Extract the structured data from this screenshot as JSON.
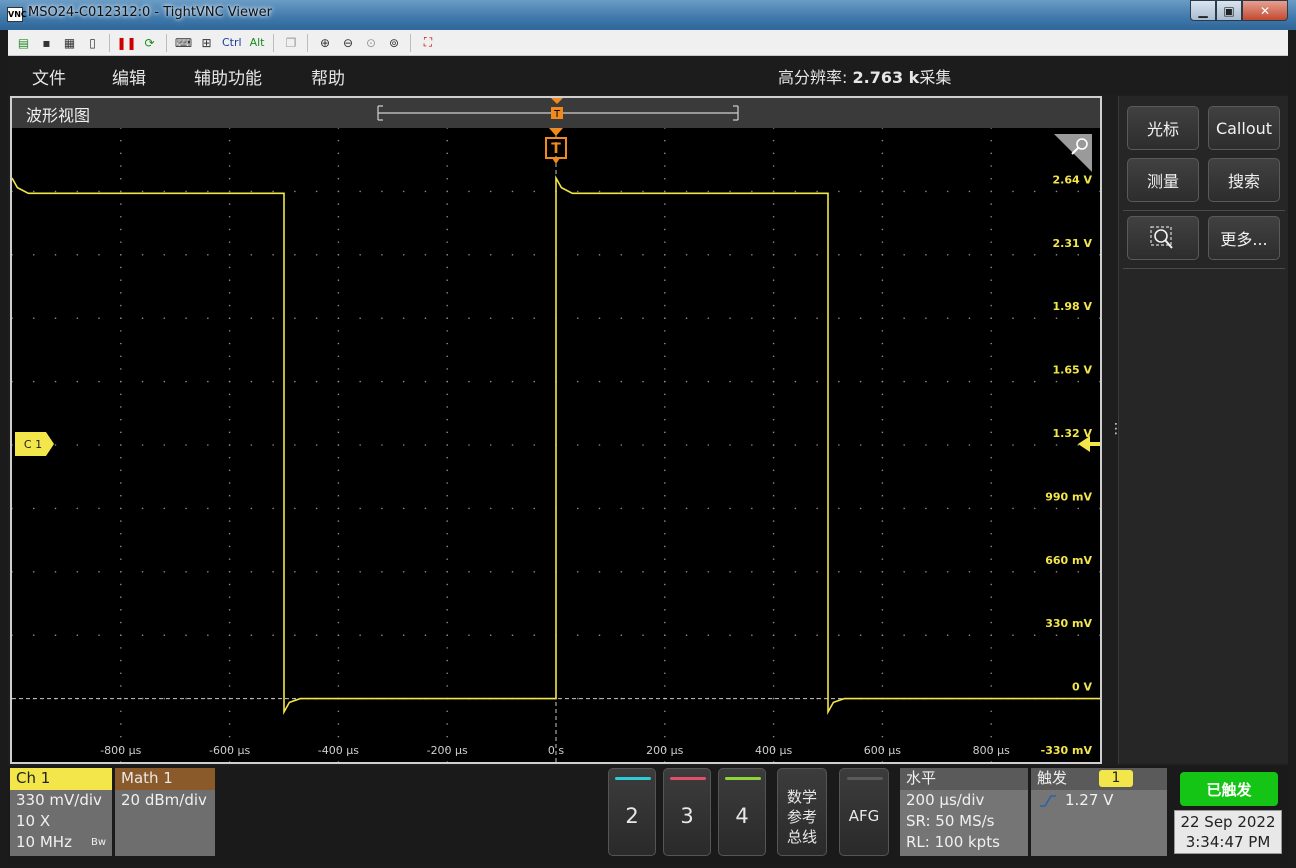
{
  "window": {
    "title": "MSO24-C012312:0 - TightVNC Viewer",
    "icon_text": "VNC"
  },
  "vnc_toolbar": {
    "ctrl_label": "Ctrl",
    "alt_label": "Alt"
  },
  "menu": {
    "items": [
      "文件",
      "编辑",
      "辅助功能",
      "帮助"
    ],
    "acq_prefix": "高分辨率:",
    "acq_value": "2.763 k",
    "acq_suffix": "采集"
  },
  "waveform_view": {
    "title": "波形视图",
    "trigger_marker": "T",
    "channel_marker": "C 1",
    "y_tick_labels": [
      "2.64 V",
      "2.31 V",
      "1.98 V",
      "1.65 V",
      "1.32 V",
      "990 mV",
      "660 mV",
      "330 mV",
      "0 V",
      "-330 mV"
    ],
    "x_tick_labels": [
      "-800 µs",
      "-600 µs",
      "-400 µs",
      "-200 µs",
      "0 s",
      "200 µs",
      "400 µs",
      "600 µs",
      "800 µs"
    ]
  },
  "chart_data": {
    "type": "line",
    "x_unit": "µs",
    "y_unit": "V",
    "xlim": [
      -1000,
      1000
    ],
    "ylim": [
      -0.33,
      2.97
    ],
    "series": [
      {
        "color": "#f2e64a",
        "x": [
          -1000,
          -990,
          -970,
          -500,
          -500,
          -490,
          -470,
          0,
          0,
          10,
          30,
          500,
          500,
          510,
          530,
          1000
        ],
        "y": [
          2.71,
          2.66,
          2.63,
          2.63,
          -0.07,
          -0.02,
          0.0,
          0.0,
          2.71,
          2.66,
          2.63,
          2.63,
          -0.07,
          -0.02,
          0.0,
          0.0
        ]
      }
    ],
    "grid": true
  },
  "right_panel": {
    "cursor_label": "光标",
    "callout_label": "Callout",
    "measure_label": "测量",
    "search_label": "搜索",
    "more_label": "更多..."
  },
  "ch1": {
    "header": "Ch 1",
    "scale": "330 mV/div",
    "probe": "10 X",
    "bandwidth": "10 MHz",
    "bw_icon": "Bw",
    "color": "#f2e64a"
  },
  "math1": {
    "header": "Math 1",
    "scale": "20 dBm/div",
    "color": "#8b5a2b"
  },
  "channel_buttons": [
    {
      "label": "2",
      "color": "#2ecbd6"
    },
    {
      "label": "3",
      "color": "#e0506a"
    },
    {
      "label": "4",
      "color": "#8fd43c"
    }
  ],
  "ref_button": {
    "line1": "数学",
    "line2": "参考",
    "line3": "总线"
  },
  "afg_button": {
    "label": "AFG"
  },
  "horizontal": {
    "header": "水平",
    "scale": "200 µs/div",
    "sample_rate": "SR: 50 MS/s",
    "record_length": "RL: 100 kpts"
  },
  "trigger": {
    "header": "触发",
    "source": "1",
    "level": "1.27 V"
  },
  "status": {
    "state": "已触发",
    "date": "22 Sep 2022",
    "time": "3:34:47 PM"
  }
}
